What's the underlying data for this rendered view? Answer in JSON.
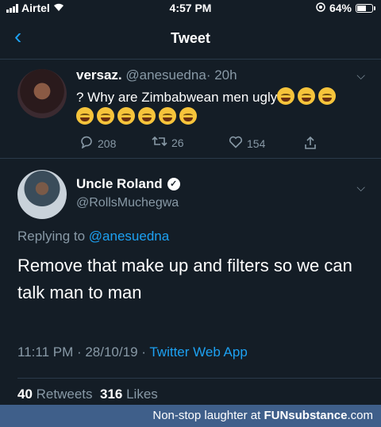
{
  "status_bar": {
    "carrier": "Airtel",
    "time": "4:57 PM",
    "battery": "64%",
    "battery_level": 0.64
  },
  "nav": {
    "title": "Tweet"
  },
  "tweet_original": {
    "name": "versaz.",
    "handle": "@anesuedna",
    "age": "· 20h",
    "text": "? Why are Zimbabwean men ugly",
    "emoji_count_line1": 3,
    "emoji_count_line2": 6,
    "replies": "208",
    "retweets": "26",
    "likes": "154"
  },
  "tweet_reply": {
    "name": "Uncle Roland",
    "handle": "@RollsMuchegwa",
    "replying_prefix": "Replying to",
    "replying_to": "@anesuedna",
    "text": "Remove that make up and filters so we can talk man to man",
    "timestamp": "11:11 PM · 28/10/19 ·",
    "source": "Twitter Web App",
    "retweets_count": "40",
    "retweets_label": "Retweets",
    "likes_count": "316",
    "likes_label": "Likes"
  },
  "watermark": {
    "prefix": "Non-stop laughter at",
    "site": "FUNsubstance",
    "suffix": ".com"
  },
  "colors": {
    "background": "#141d26",
    "accent": "#1da1f2",
    "muted": "#8899a6",
    "footer": "#3f5f8a"
  }
}
